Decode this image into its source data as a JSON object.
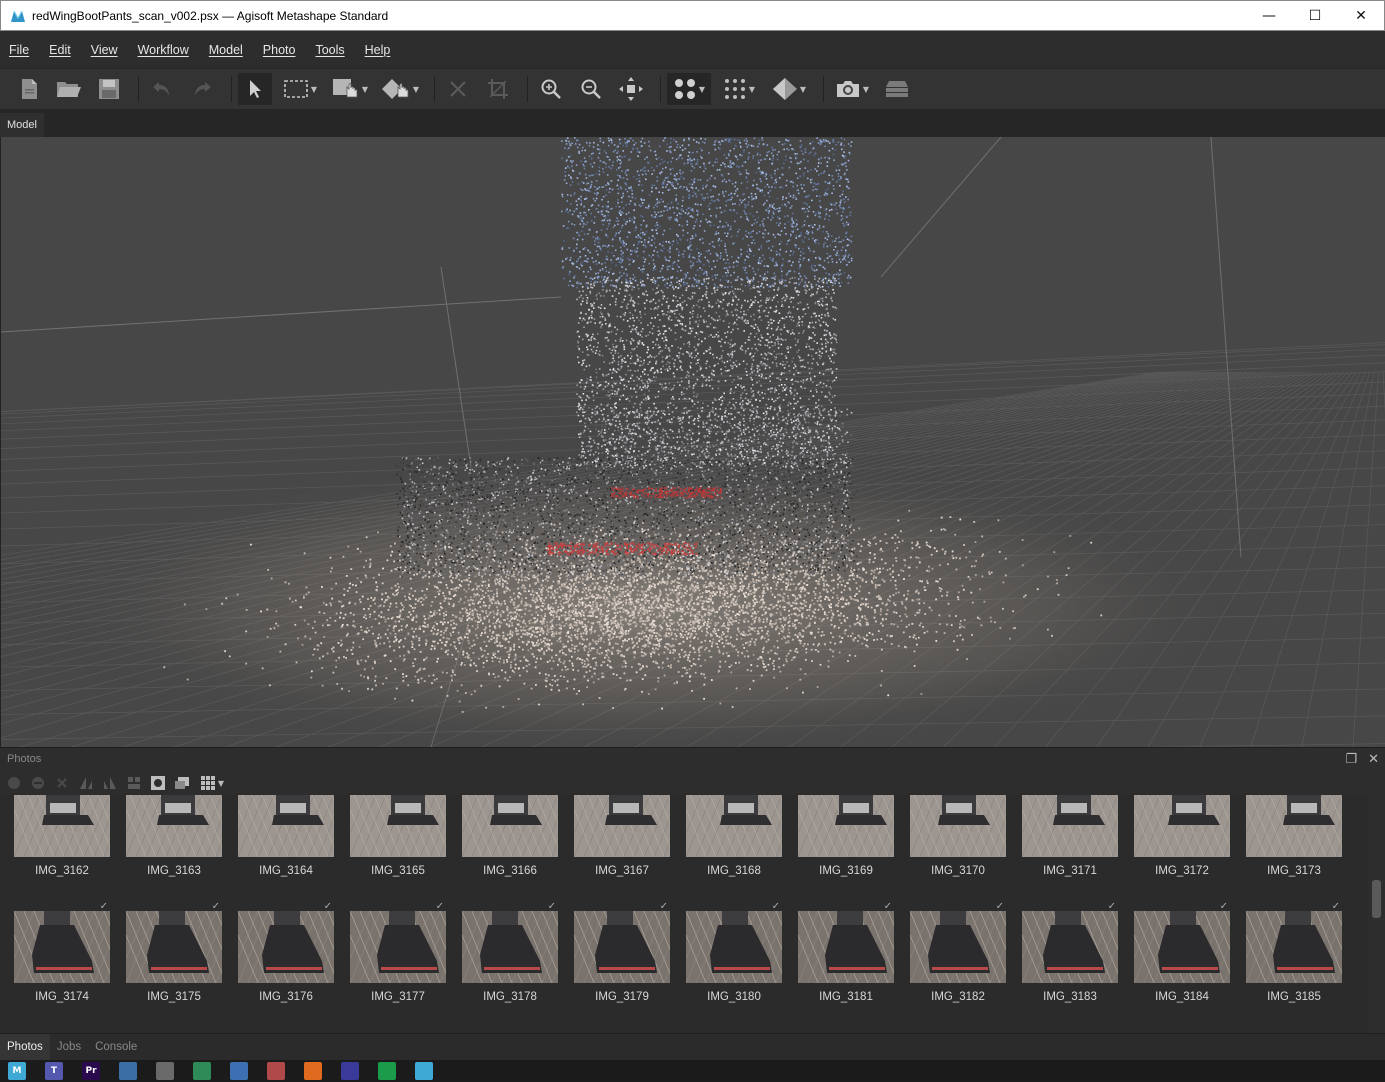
{
  "window": {
    "title": "redWingBootPants_scan_v002.psx — Agisoft Metashape Standard",
    "controls": {
      "minimize": "—",
      "maximize": "☐",
      "close": "✕"
    }
  },
  "menu": [
    "File",
    "Edit",
    "View",
    "Workflow",
    "Model",
    "Photo",
    "Tools",
    "Help"
  ],
  "toolbar": {
    "icons": [
      "new-document-icon",
      "open-folder-icon",
      "save-icon",
      "undo-icon",
      "redo-icon",
      "navigation-arrow-icon",
      "rectangle-selection-icon",
      "intelligent-paint-icon",
      "intelligent-scissors-icon",
      "delete-selection-icon",
      "crop-icon",
      "zoom-in-icon",
      "zoom-out-icon",
      "reset-view-icon",
      "point-cloud-icon",
      "dense-cloud-icon",
      "model-shaded-icon",
      "camera-icon",
      "tiled-model-icon"
    ]
  },
  "model_tab": {
    "label": "Model"
  },
  "photos_pane": {
    "title": "Photos",
    "row1": [
      "IMG_3162",
      "IMG_3163",
      "IMG_3164",
      "IMG_3165",
      "IMG_3166",
      "IMG_3167",
      "IMG_3168",
      "IMG_3169",
      "IMG_3170",
      "IMG_3171",
      "IMG_3172",
      "IMG_3173"
    ],
    "row2": [
      "IMG_3174",
      "IMG_3175",
      "IMG_3176",
      "IMG_3177",
      "IMG_3178",
      "IMG_3179",
      "IMG_3180",
      "IMG_3181",
      "IMG_3182",
      "IMG_3183",
      "IMG_3184",
      "IMG_3185"
    ]
  },
  "bottom_tabs": [
    "Photos",
    "Jobs",
    "Console"
  ],
  "taskbar": {
    "apps": [
      {
        "icon": "metashape-icon",
        "label": "M",
        "color": "#3fa9d6"
      },
      {
        "icon": "teams-icon",
        "label": "T",
        "color": "#5558af"
      },
      {
        "icon": "premiere-icon",
        "label": "Pr",
        "color": "#2a0a4d"
      },
      {
        "icon": "browser-icon",
        "label": "",
        "color": "#3a6ea5"
      },
      {
        "icon": "image-viewer-icon",
        "label": "",
        "color": "#6a6a6a"
      },
      {
        "icon": "monitor-icon",
        "label": "",
        "color": "#2e8b57"
      },
      {
        "icon": "tool-icon",
        "label": "",
        "color": "#3d6fb3"
      },
      {
        "icon": "paint-icon",
        "label": "",
        "color": "#b04a4a"
      },
      {
        "icon": "houdini-icon",
        "label": "",
        "color": "#e06b1f"
      },
      {
        "icon": "editor-icon",
        "label": "",
        "color": "#3a3a9a"
      },
      {
        "icon": "chat-icon",
        "label": "",
        "color": "#1a9c4a"
      },
      {
        "icon": "metashape-window-icon",
        "label": "",
        "color": "#3fa9d6"
      }
    ]
  }
}
